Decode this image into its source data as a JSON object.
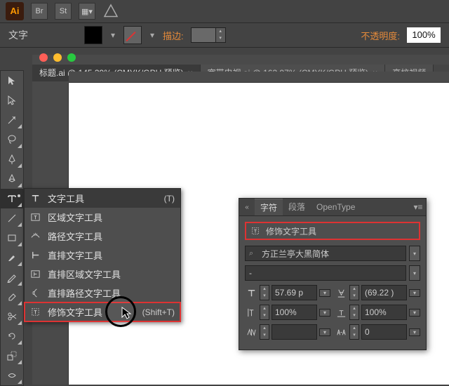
{
  "menubar": {
    "icons": [
      "Br",
      "St"
    ],
    "mode_label": "文字"
  },
  "toolbar": {
    "stroke_label": "描边:",
    "stroke_val": "",
    "opacity_label": "不透明度:",
    "opacity_val": "100%"
  },
  "tabs": [
    {
      "label": "标题.ai @ 145.39% (CMYK/GPU 预览)",
      "active": true
    },
    {
      "label": "宽带电视.ai @ 163.97% (CMYK/GPU 预览)",
      "active": false
    },
    {
      "label": "高校视频",
      "active": false
    }
  ],
  "type_flyout": {
    "items": [
      {
        "label": "文字工具",
        "shortcut": "(T)"
      },
      {
        "label": "区域文字工具",
        "shortcut": ""
      },
      {
        "label": "路径文字工具",
        "shortcut": ""
      },
      {
        "label": "直排文字工具",
        "shortcut": ""
      },
      {
        "label": "直排区域文字工具",
        "shortcut": ""
      },
      {
        "label": "直排路径文字工具",
        "shortcut": ""
      },
      {
        "label": "修饰文字工具",
        "shortcut": "(Shift+T)"
      }
    ]
  },
  "char_panel": {
    "tabs": [
      "字符",
      "段落",
      "OpenType"
    ],
    "active_tool": "修饰文字工具",
    "font": "方正兰亭大黑简体",
    "style": "-",
    "size": "57.69 p",
    "leading": "(69.22 )",
    "hscale": "100%",
    "vscale": "100%",
    "tracking1": "",
    "tracking2": "0"
  }
}
